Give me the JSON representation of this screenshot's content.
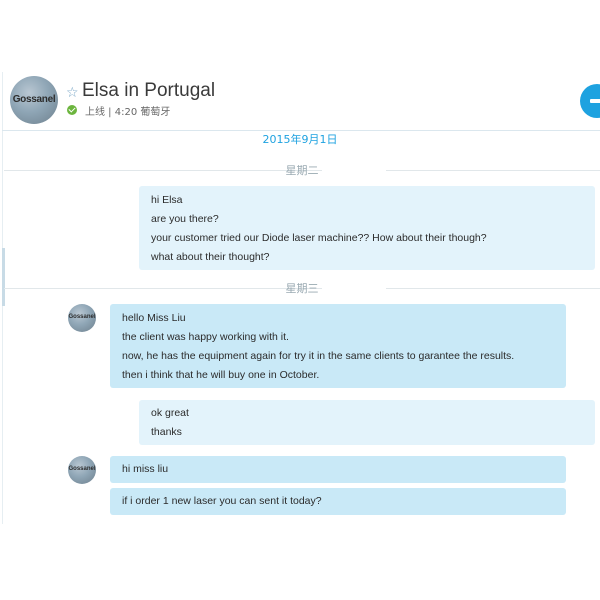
{
  "contact": {
    "name": "Elsa in Portugal",
    "status": "上线 | 4:20 葡萄牙",
    "avatar_text": "Gossanel"
  },
  "date": "2015年9月1日",
  "days": [
    "星期二",
    "星期三"
  ],
  "messages": [
    {
      "sender": "me",
      "lines": [
        "hi Elsa",
        "are you there?",
        "your customer tried our Diode laser machine?? How about their though?",
        "what about their thought?"
      ]
    },
    {
      "sender": "contact",
      "lines": [
        "hello Miss Liu",
        "the client was happy working with it.",
        "now, he has the equipment again for try it in the same clients to garantee the results.",
        "then i think that he will buy one in October."
      ]
    },
    {
      "sender": "me",
      "lines": [
        "ok  great",
        "thanks"
      ]
    },
    {
      "sender": "contact",
      "lines": [
        "hi miss liu"
      ]
    },
    {
      "sender": "contact",
      "lines": [
        "if i order 1 new laser you can sent it today?"
      ]
    }
  ],
  "colors": {
    "accent": "#1ea2e0",
    "online": "#6cb53e",
    "bubble_mine": "#e3f3fb",
    "bubble_theirs": "#c9e9f7"
  },
  "icons": {
    "favorite": "star-icon",
    "status": "online-check-icon",
    "call": "call-button-icon"
  }
}
